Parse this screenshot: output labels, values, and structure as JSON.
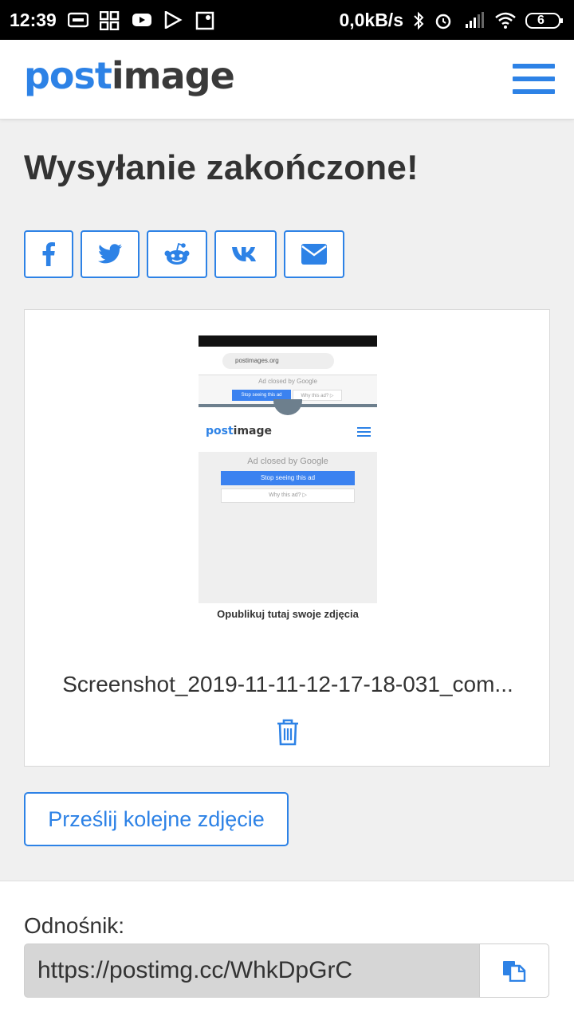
{
  "status_bar": {
    "time": "12:39",
    "net_speed": "0,0kB/s",
    "battery": "6"
  },
  "header": {
    "logo_part1": "post",
    "logo_part2": "image",
    "colors": {
      "accent": "#2d82e6",
      "dark": "#3a3a3a"
    }
  },
  "page": {
    "title": "Wysyłanie zakończone!"
  },
  "share_buttons": [
    {
      "icon": "facebook-icon"
    },
    {
      "icon": "twitter-icon"
    },
    {
      "icon": "reddit-icon"
    },
    {
      "icon": "vk-icon"
    },
    {
      "icon": "email-icon"
    }
  ],
  "upload": {
    "filename": "Screenshot_2019-11-11-12-17-18-031_com...",
    "thumbnail": {
      "url_bar": "postimages.org",
      "ad_closed": "Ad closed by Google",
      "stop_seeing": "Stop seeing this ad",
      "why_this_ad": "Why this ad? ▷",
      "logo_part1": "post",
      "logo_part2": "image",
      "caption": "Opublikuj tutaj swoje zdjęcia"
    }
  },
  "actions": {
    "upload_again": "Prześlij kolejne zdjęcie"
  },
  "link": {
    "label": "Odnośnik:",
    "value": "https://postimg.cc/WhkDpGrC"
  }
}
